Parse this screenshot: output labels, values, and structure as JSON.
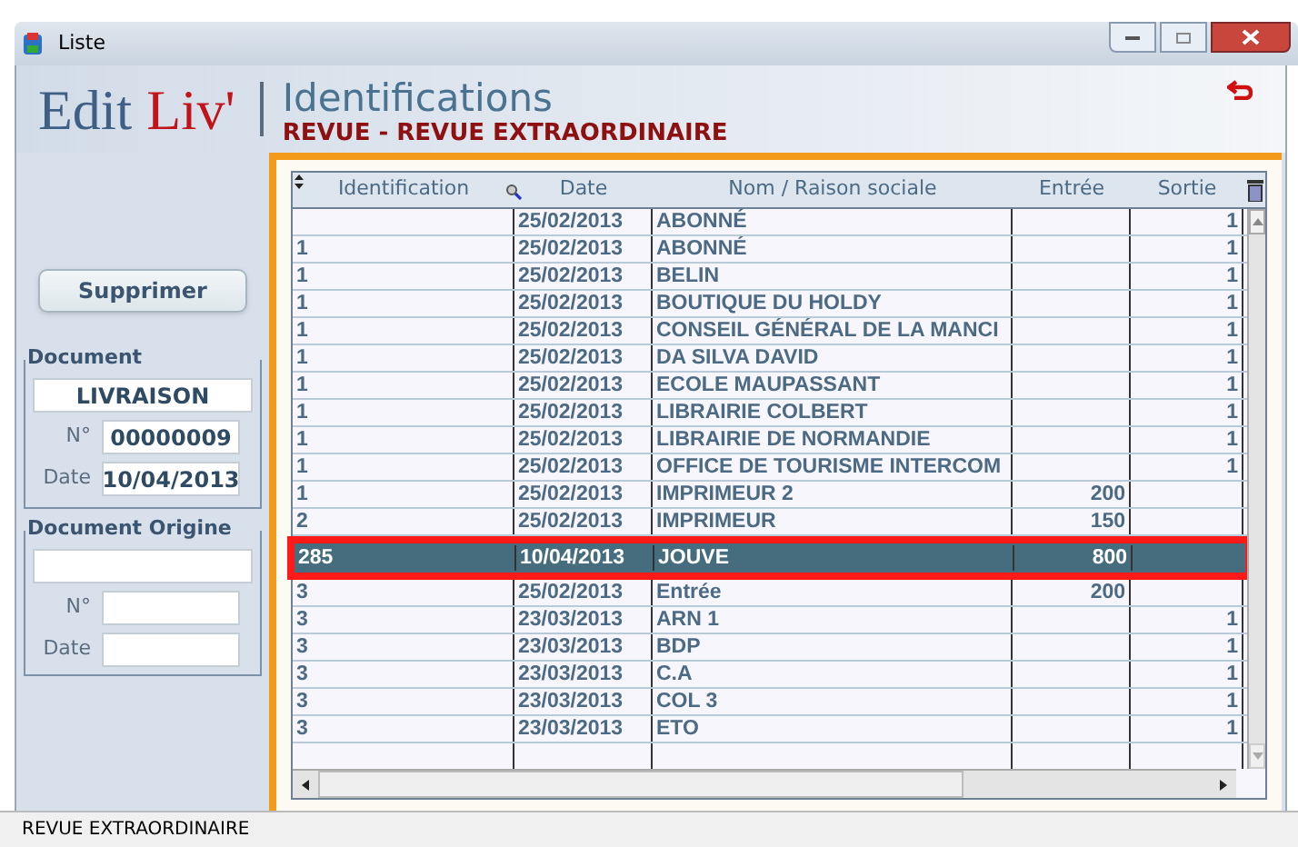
{
  "window": {
    "title": "Liste"
  },
  "header": {
    "logo_main": "Edit",
    "logo_accent": "Liv'",
    "title": "Identifications",
    "subtitle": "REVUE - REVUE EXTRAORDINAIRE"
  },
  "sidebar": {
    "delete_button": "Supprimer",
    "document": {
      "legend": "Document",
      "type": "LIVRAISON",
      "number_label": "N°",
      "number": "00000009",
      "date_label": "Date",
      "date": "10/04/2013"
    },
    "origin": {
      "legend": "Document Origine",
      "number_label": "N°",
      "date_label": "Date"
    }
  },
  "table": {
    "columns": [
      "Identification",
      "Date",
      "Nom / Raison sociale",
      "Entrée",
      "Sortie"
    ],
    "rows": [
      {
        "identification": "",
        "date": "25/02/2013",
        "name": "ABONNÉ",
        "entree": "",
        "sortie": "1",
        "selected": false
      },
      {
        "identification": "1",
        "date": "25/02/2013",
        "name": "ABONNÉ",
        "entree": "",
        "sortie": "1",
        "selected": false
      },
      {
        "identification": "1",
        "date": "25/02/2013",
        "name": "BELIN",
        "entree": "",
        "sortie": "1",
        "selected": false
      },
      {
        "identification": "1",
        "date": "25/02/2013",
        "name": "BOUTIQUE DU HOLDY",
        "entree": "",
        "sortie": "1",
        "selected": false
      },
      {
        "identification": "1",
        "date": "25/02/2013",
        "name": "CONSEIL GÉNÉRAL DE LA MANCI",
        "entree": "",
        "sortie": "1",
        "selected": false
      },
      {
        "identification": "1",
        "date": "25/02/2013",
        "name": "DA SILVA DAVID",
        "entree": "",
        "sortie": "1",
        "selected": false
      },
      {
        "identification": "1",
        "date": "25/02/2013",
        "name": "ECOLE MAUPASSANT",
        "entree": "",
        "sortie": "1",
        "selected": false
      },
      {
        "identification": "1",
        "date": "25/02/2013",
        "name": "LIBRAIRIE COLBERT",
        "entree": "",
        "sortie": "1",
        "selected": false
      },
      {
        "identification": "1",
        "date": "25/02/2013",
        "name": "LIBRAIRIE DE NORMANDIE",
        "entree": "",
        "sortie": "1",
        "selected": false
      },
      {
        "identification": "1",
        "date": "25/02/2013",
        "name": "OFFICE DE TOURISME INTERCOM",
        "entree": "",
        "sortie": "1",
        "selected": false
      },
      {
        "identification": "1",
        "date": "25/02/2013",
        "name": "IMPRIMEUR 2",
        "entree": "200",
        "sortie": "",
        "selected": false
      },
      {
        "identification": "2",
        "date": "25/02/2013",
        "name": "IMPRIMEUR",
        "entree": "150",
        "sortie": "",
        "selected": false
      },
      {
        "identification": "285",
        "date": "10/04/2013",
        "name": "JOUVE",
        "entree": "800",
        "sortie": "",
        "selected": true
      },
      {
        "identification": "3",
        "date": "25/02/2013",
        "name": "Entrée",
        "entree": "200",
        "sortie": "",
        "selected": false
      },
      {
        "identification": "3",
        "date": "23/03/2013",
        "name": "ARN  1",
        "entree": "",
        "sortie": "1",
        "selected": false
      },
      {
        "identification": "3",
        "date": "23/03/2013",
        "name": "BDP",
        "entree": "",
        "sortie": "1",
        "selected": false
      },
      {
        "identification": "3",
        "date": "23/03/2013",
        "name": "C.A",
        "entree": "",
        "sortie": "1",
        "selected": false
      },
      {
        "identification": "3",
        "date": "23/03/2013",
        "name": "COL  3",
        "entree": "",
        "sortie": "1",
        "selected": false
      },
      {
        "identification": "3",
        "date": "23/03/2013",
        "name": "ETO",
        "entree": "",
        "sortie": "1",
        "selected": false
      }
    ]
  },
  "status_bar": {
    "text": "REVUE EXTRAORDINAIRE"
  }
}
